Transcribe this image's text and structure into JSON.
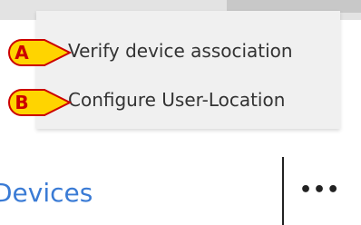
{
  "menu": {
    "items": [
      {
        "label": "Verify device association",
        "callout": "A"
      },
      {
        "label": "Configure User-Location",
        "callout": "B"
      }
    ]
  },
  "footer": {
    "devices_label": "Devices",
    "more_label": "•••"
  },
  "colors": {
    "callout_fill": "#ffd400",
    "callout_stroke": "#cc0000",
    "link_blue": "#3a7bd5"
  }
}
